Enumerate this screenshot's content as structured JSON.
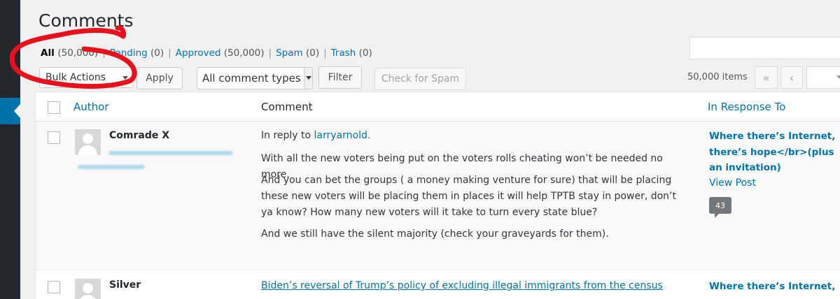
{
  "page": {
    "title": "Comments"
  },
  "filters": [
    {
      "label": "All",
      "count": "(50,000)"
    },
    {
      "label": "Pending",
      "count": "(0)"
    },
    {
      "label": "Approved",
      "count": "(50,000)"
    },
    {
      "label": "Spam",
      "count": "(0)"
    },
    {
      "label": "Trash",
      "count": "(0)"
    }
  ],
  "separator": "|",
  "toolbar": {
    "bulk_actions": "Bulk Actions",
    "apply_label": "Apply",
    "comment_types": "All comment types",
    "filter_label": "Filter",
    "check_spam_label": "Check for Spam",
    "items_count": "50,000 items",
    "first_page": "«",
    "prev_page": "‹"
  },
  "table": {
    "headers": {
      "author": "Author",
      "comment": "Comment",
      "response": "In Response To"
    },
    "rows": [
      {
        "author": "Comrade X",
        "reply_prefix": "In reply to",
        "reply_to": "larryarnold.",
        "paragraphs": [
          "With all the new voters being put on the voters rolls cheating won’t be needed no more.",
          "And you can bet the groups ( a money making venture for sure) that will be placing these new voters will be placing them in places it will help TPTB stay in power, don’t ya know? How many new voters will it take to turn every state blue?",
          "And we still have the silent majority (check your graveyards for them)."
        ],
        "response_title": "Where there’s Internet, there’s hope</br>(plus an invitation)",
        "view_post": "View Post",
        "comment_count": "43"
      },
      {
        "author": "Silver",
        "link_text": "Biden’s reversal of Trump’s policy of excluding illegal immigrants from the census",
        "response_title": "Where there’s Internet,"
      }
    ]
  },
  "annotation_color": "#e8101c"
}
